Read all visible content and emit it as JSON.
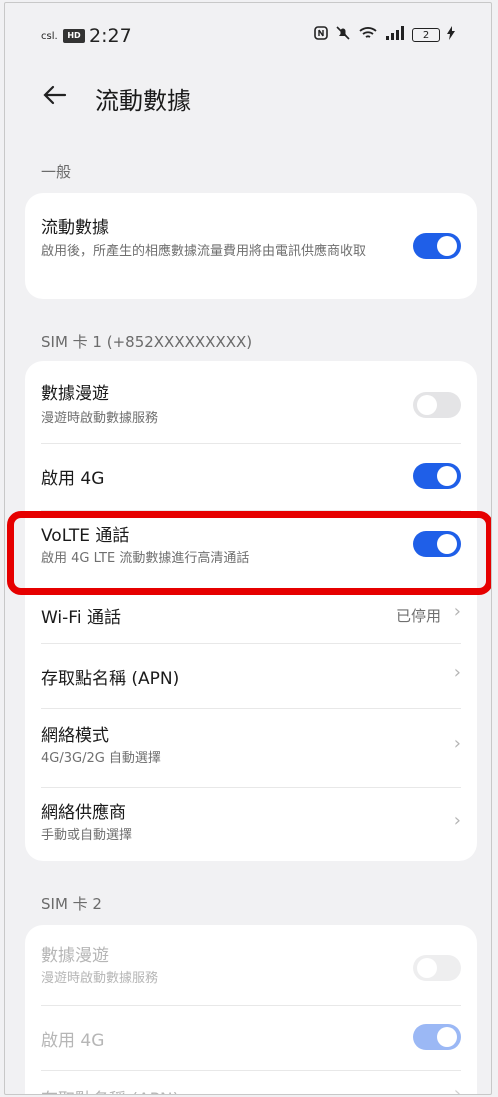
{
  "status_bar": {
    "carrier": "csl.",
    "hd": "HD",
    "time": "2:27",
    "battery": "2"
  },
  "header": {
    "back_icon": "arrow-left-icon",
    "title": "流動數據"
  },
  "general": {
    "label": "一般",
    "mobile_data": {
      "title": "流動數據",
      "subtitle": "啟用後，所產生的相應數據流量費用將由電訊供應商收取",
      "enabled": true
    }
  },
  "sim1": {
    "label": "SIM 卡 1 (+852XXXXXXXXX)",
    "roaming": {
      "title": "數據漫遊",
      "subtitle": "漫遊時啟動數據服務",
      "enabled": false
    },
    "enable_4g": {
      "title": "啟用 4G",
      "enabled": true
    },
    "volte": {
      "title": "VoLTE 通話",
      "subtitle": "啟用 4G LTE 流動數據進行高清通話",
      "enabled": true
    },
    "wifi_calling": {
      "title": "Wi-Fi 通話",
      "status": "已停用"
    },
    "apn": {
      "title": "存取點名稱 (APN)"
    },
    "network_mode": {
      "title": "網絡模式",
      "subtitle": "4G/3G/2G 自動選擇"
    },
    "carrier": {
      "title": "網絡供應商",
      "subtitle": "手動或自動選擇"
    }
  },
  "sim2": {
    "label": "SIM 卡 2",
    "roaming": {
      "title": "數據漫遊",
      "subtitle": "漫遊時啟動數據服務",
      "enabled": false
    },
    "enable_4g": {
      "title": "啟用 4G",
      "enabled": true
    },
    "apn": {
      "title": "存取點名稱 (APN)"
    }
  },
  "colors": {
    "accent": "#1f5fe8",
    "highlight": "#e60000"
  }
}
